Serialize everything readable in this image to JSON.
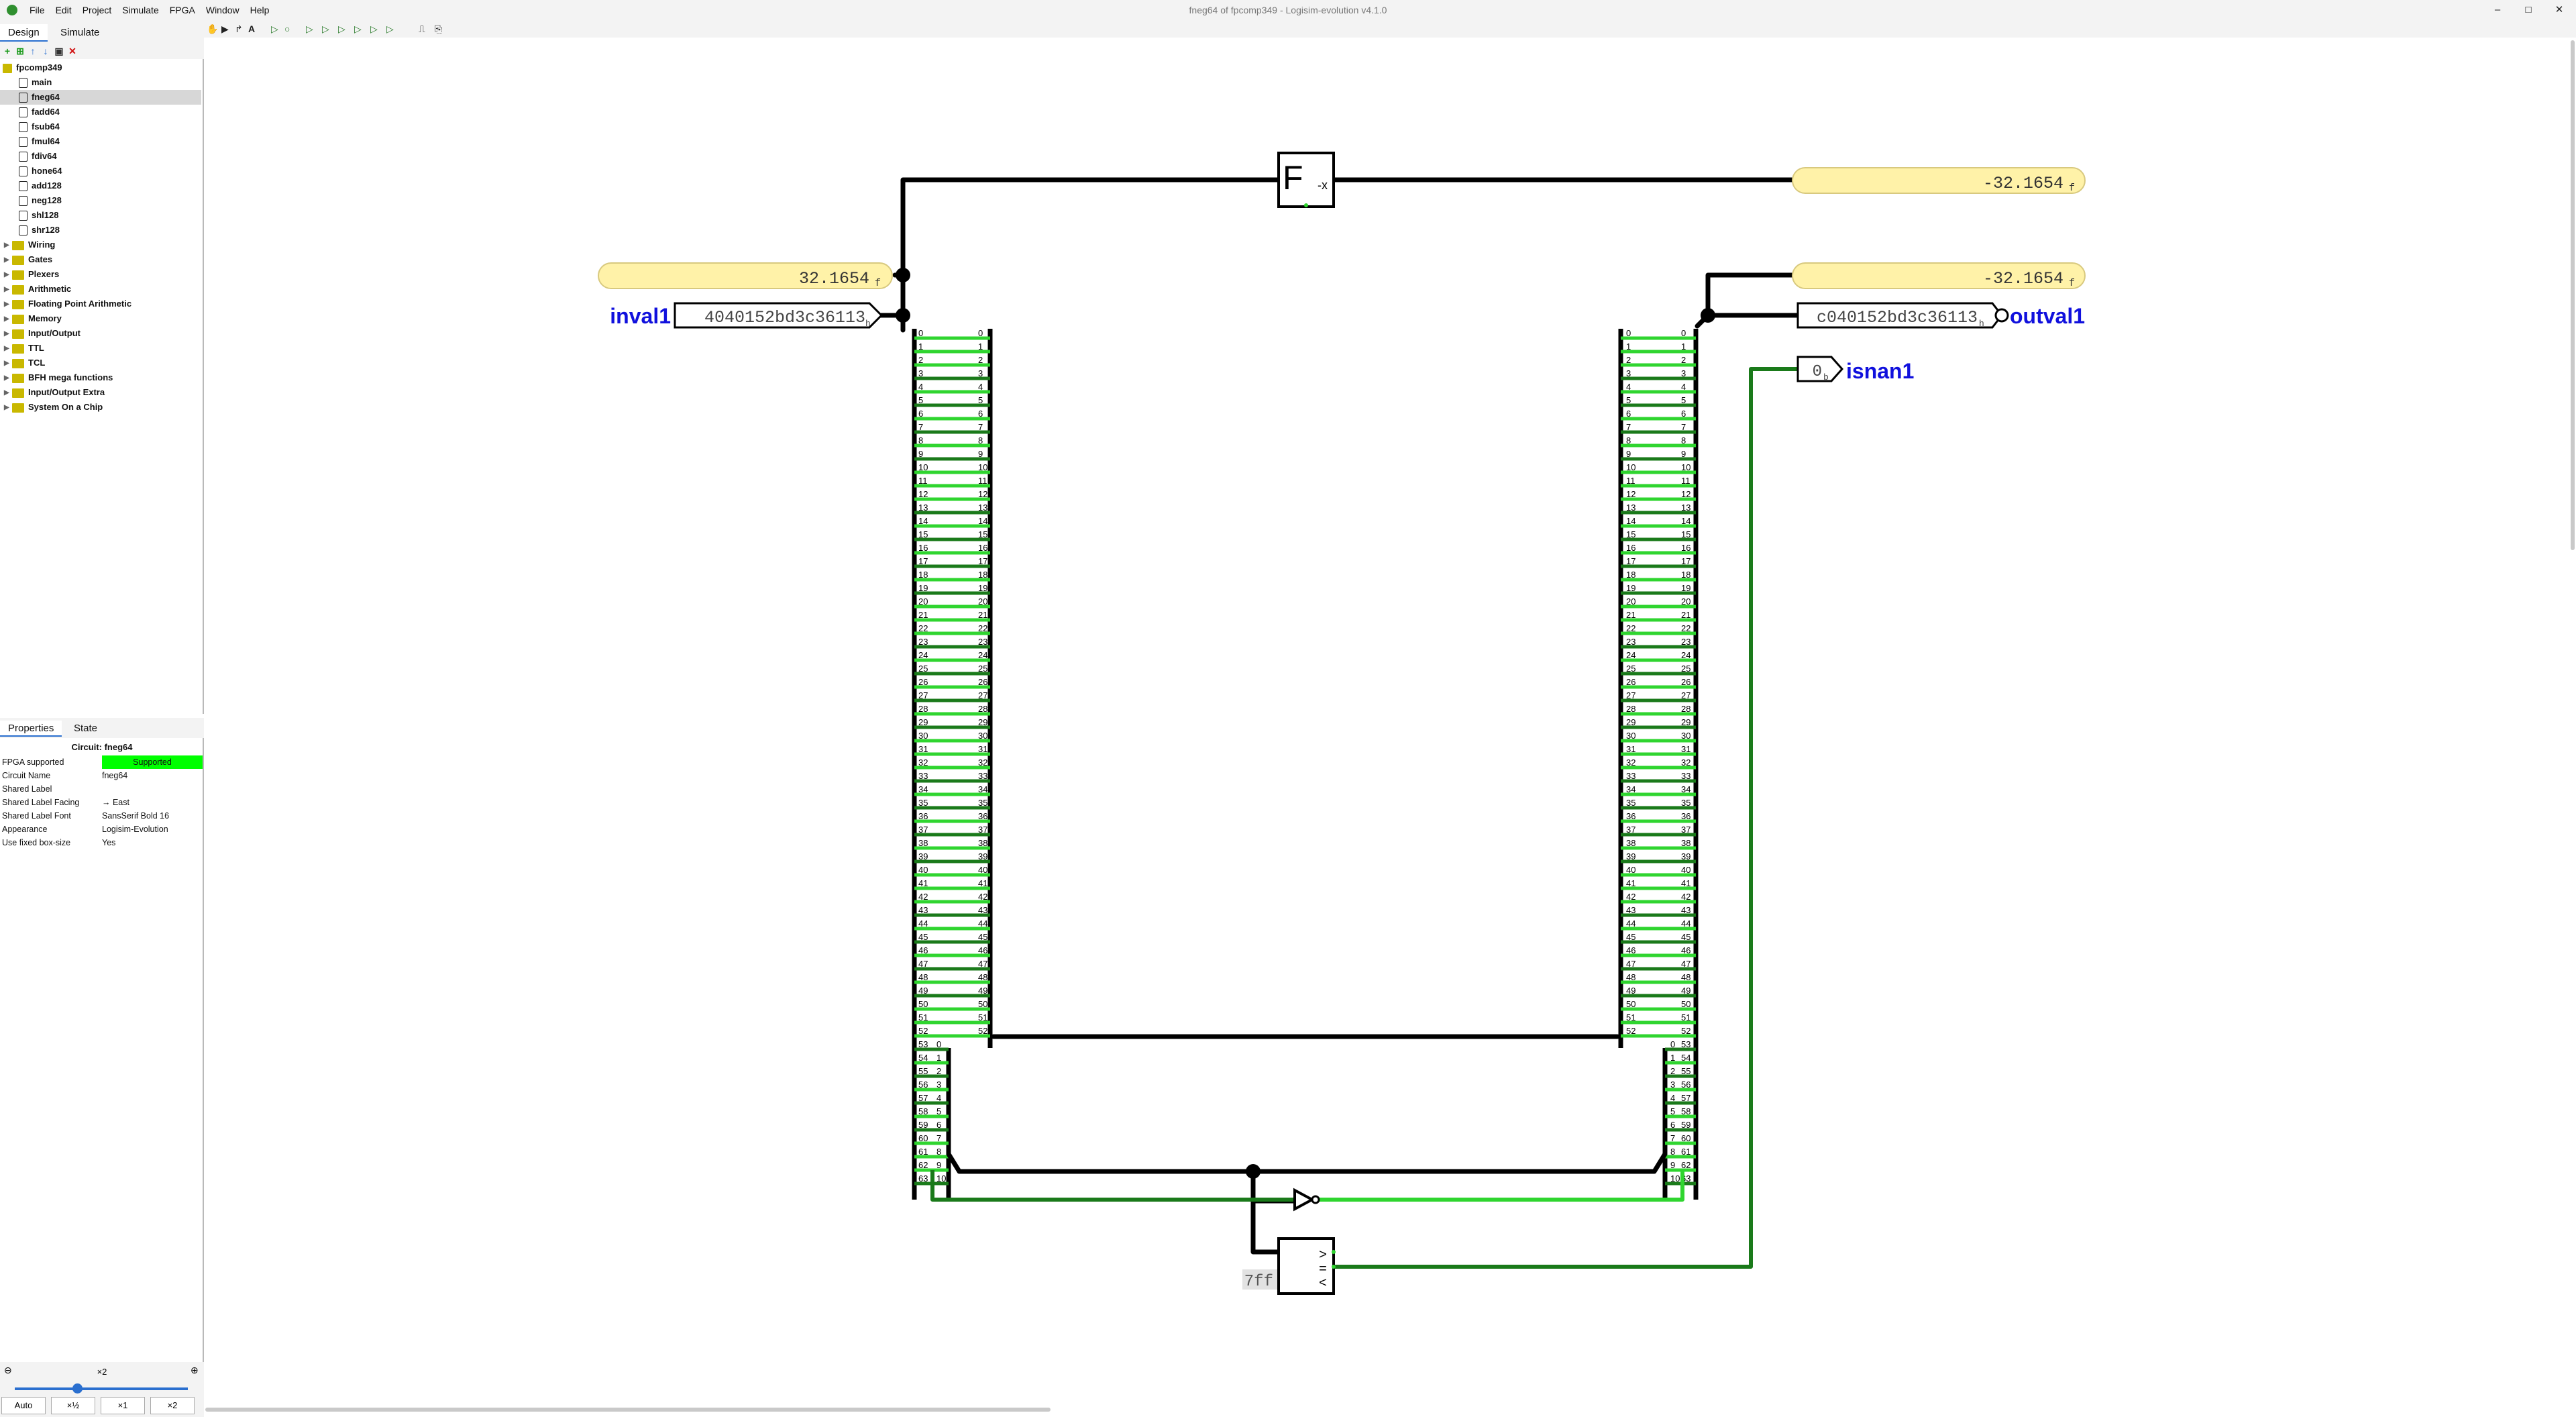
{
  "window": {
    "title": "fneg64 of fpcomp349 - Logisim-evolution v4.1.0",
    "menu": [
      "File",
      "Edit",
      "Project",
      "Simulate",
      "FPGA",
      "Window",
      "Help"
    ],
    "controls": {
      "minimize": "–",
      "maximize": "□",
      "close": "✕"
    }
  },
  "left_tabs": {
    "design": "Design",
    "simulate": "Simulate"
  },
  "tree": {
    "project": "fpcomp349",
    "circuits": [
      "main",
      "fneg64",
      "fadd64",
      "fsub64",
      "fmul64",
      "fdiv64",
      "hone64",
      "add128",
      "neg128",
      "shl128",
      "shr128"
    ],
    "selected": "fneg64",
    "libraries": [
      "Wiring",
      "Gates",
      "Plexers",
      "Arithmetic",
      "Floating Point Arithmetic",
      "Memory",
      "Input/Output",
      "TTL",
      "TCL",
      "BFH mega functions",
      "Input/Output Extra",
      "System On a Chip"
    ]
  },
  "prop_tabs": {
    "properties": "Properties",
    "state": "State"
  },
  "properties": {
    "title": "Circuit: fneg64",
    "rows": [
      {
        "key": "FPGA supported",
        "value": "Supported"
      },
      {
        "key": "Circuit Name",
        "value": "fneg64"
      },
      {
        "key": "Shared Label",
        "value": ""
      },
      {
        "key": "Shared Label Facing",
        "value": "→ East"
      },
      {
        "key": "Shared Label Font",
        "value": "SansSerif Bold 16"
      },
      {
        "key": "Appearance",
        "value": "Logisim-Evolution"
      },
      {
        "key": "Use fixed box-size",
        "value": "Yes"
      }
    ]
  },
  "zoom": {
    "level": "×2",
    "buttons": [
      "Auto",
      "×½",
      "×1",
      "×2"
    ],
    "slider": 0.42
  },
  "circuit": {
    "probe_in_value": "32.1654",
    "probe_neg_value": "-32.1654",
    "probe_out_value": "-32.1654",
    "probe_suffix": "f",
    "inval_pin": {
      "label": "inval1",
      "value": "4040152bd3c36113",
      "suffix": "h"
    },
    "outval_pin": {
      "label": "outval1",
      "value": "c040152bd3c36113",
      "suffix": "h"
    },
    "isnan_pin": {
      "label": "isnan1",
      "value": "0",
      "suffix": "b"
    },
    "fp_neg_label": "F",
    "fp_neg_sub": "-x",
    "const_value": "7ff",
    "comparator_symbols": [
      ">",
      "=",
      "<"
    ],
    "splitter_bits": 64,
    "split_hi_field": 11
  },
  "colors": {
    "wire": "#000000",
    "bit_on": "#2fd52f",
    "bit_dark": "#1a7a1a",
    "label": "#1010dd",
    "probe": "#fff2a8"
  }
}
